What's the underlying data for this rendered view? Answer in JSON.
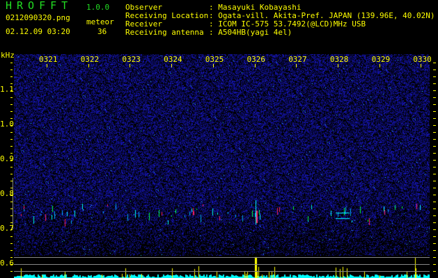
{
  "app": {
    "title": "HROFFT",
    "version": "1.0.0"
  },
  "file": {
    "name": "0212090320.png",
    "datetime": "02.12.09 03:20"
  },
  "meteor": {
    "label": "meteor",
    "count": "36"
  },
  "info": [
    {
      "label": "Observer",
      "value": ": Masayuki Kobayashi"
    },
    {
      "label": "Receiving Location",
      "value": ": Ogata-vill. Akita-Pref. JAPAN (139.96E, 40.02N)"
    },
    {
      "label": "Receiver",
      "value": ": ICOM IC-575 53.7492(@LCD)MHz USB"
    },
    {
      "label": "Receiving antenna",
      "value": ": A504HB(yagi 4el)"
    }
  ],
  "spectrogram": {
    "freq_unit": "kHz",
    "time_labels": [
      "0321",
      "0322",
      "0323",
      "0324",
      "0325",
      "0326",
      "0327",
      "0328",
      "0329",
      "0330"
    ],
    "freq_labels": [
      "1.1",
      "1.0",
      "0.9",
      "0.8",
      "0.7",
      "0.6"
    ],
    "colors": {
      "background": "#000000",
      "noise": "#1a1aff",
      "echo_low": "#00ffff",
      "echo_mid": "#00ff44",
      "echo_high": "#ff2060",
      "histogram": "#00ffff",
      "histogram_peak": "#ffff00",
      "text": "#ffff00",
      "title": "#22dd22"
    }
  }
}
